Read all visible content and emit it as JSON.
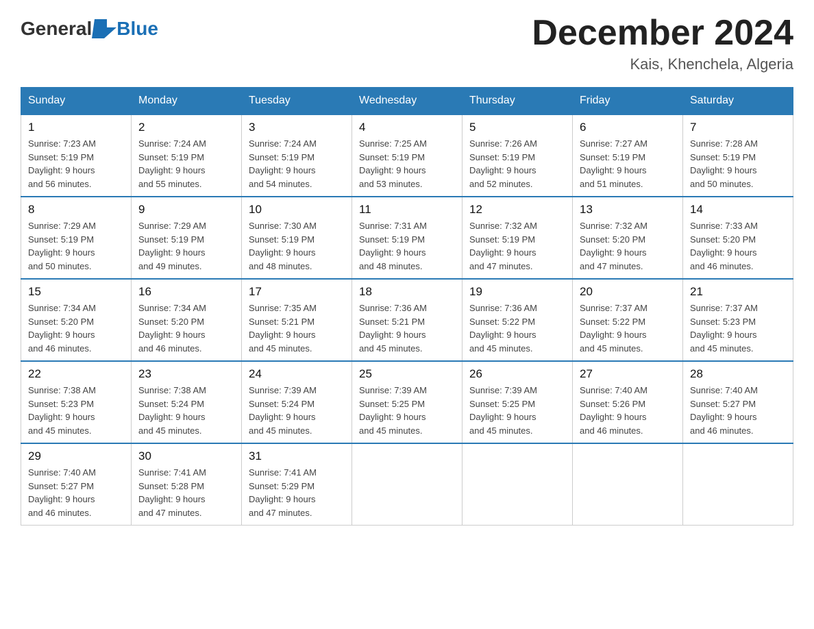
{
  "header": {
    "logo": {
      "general": "General",
      "blue": "Blue"
    },
    "title": "December 2024",
    "location": "Kais, Khenchela, Algeria"
  },
  "weekdays": [
    "Sunday",
    "Monday",
    "Tuesday",
    "Wednesday",
    "Thursday",
    "Friday",
    "Saturday"
  ],
  "weeks": [
    [
      {
        "day": "1",
        "sunrise": "7:23 AM",
        "sunset": "5:19 PM",
        "daylight": "9 hours and 56 minutes."
      },
      {
        "day": "2",
        "sunrise": "7:24 AM",
        "sunset": "5:19 PM",
        "daylight": "9 hours and 55 minutes."
      },
      {
        "day": "3",
        "sunrise": "7:24 AM",
        "sunset": "5:19 PM",
        "daylight": "9 hours and 54 minutes."
      },
      {
        "day": "4",
        "sunrise": "7:25 AM",
        "sunset": "5:19 PM",
        "daylight": "9 hours and 53 minutes."
      },
      {
        "day": "5",
        "sunrise": "7:26 AM",
        "sunset": "5:19 PM",
        "daylight": "9 hours and 52 minutes."
      },
      {
        "day": "6",
        "sunrise": "7:27 AM",
        "sunset": "5:19 PM",
        "daylight": "9 hours and 51 minutes."
      },
      {
        "day": "7",
        "sunrise": "7:28 AM",
        "sunset": "5:19 PM",
        "daylight": "9 hours and 50 minutes."
      }
    ],
    [
      {
        "day": "8",
        "sunrise": "7:29 AM",
        "sunset": "5:19 PM",
        "daylight": "9 hours and 50 minutes."
      },
      {
        "day": "9",
        "sunrise": "7:29 AM",
        "sunset": "5:19 PM",
        "daylight": "9 hours and 49 minutes."
      },
      {
        "day": "10",
        "sunrise": "7:30 AM",
        "sunset": "5:19 PM",
        "daylight": "9 hours and 48 minutes."
      },
      {
        "day": "11",
        "sunrise": "7:31 AM",
        "sunset": "5:19 PM",
        "daylight": "9 hours and 48 minutes."
      },
      {
        "day": "12",
        "sunrise": "7:32 AM",
        "sunset": "5:19 PM",
        "daylight": "9 hours and 47 minutes."
      },
      {
        "day": "13",
        "sunrise": "7:32 AM",
        "sunset": "5:20 PM",
        "daylight": "9 hours and 47 minutes."
      },
      {
        "day": "14",
        "sunrise": "7:33 AM",
        "sunset": "5:20 PM",
        "daylight": "9 hours and 46 minutes."
      }
    ],
    [
      {
        "day": "15",
        "sunrise": "7:34 AM",
        "sunset": "5:20 PM",
        "daylight": "9 hours and 46 minutes."
      },
      {
        "day": "16",
        "sunrise": "7:34 AM",
        "sunset": "5:20 PM",
        "daylight": "9 hours and 46 minutes."
      },
      {
        "day": "17",
        "sunrise": "7:35 AM",
        "sunset": "5:21 PM",
        "daylight": "9 hours and 45 minutes."
      },
      {
        "day": "18",
        "sunrise": "7:36 AM",
        "sunset": "5:21 PM",
        "daylight": "9 hours and 45 minutes."
      },
      {
        "day": "19",
        "sunrise": "7:36 AM",
        "sunset": "5:22 PM",
        "daylight": "9 hours and 45 minutes."
      },
      {
        "day": "20",
        "sunrise": "7:37 AM",
        "sunset": "5:22 PM",
        "daylight": "9 hours and 45 minutes."
      },
      {
        "day": "21",
        "sunrise": "7:37 AM",
        "sunset": "5:23 PM",
        "daylight": "9 hours and 45 minutes."
      }
    ],
    [
      {
        "day": "22",
        "sunrise": "7:38 AM",
        "sunset": "5:23 PM",
        "daylight": "9 hours and 45 minutes."
      },
      {
        "day": "23",
        "sunrise": "7:38 AM",
        "sunset": "5:24 PM",
        "daylight": "9 hours and 45 minutes."
      },
      {
        "day": "24",
        "sunrise": "7:39 AM",
        "sunset": "5:24 PM",
        "daylight": "9 hours and 45 minutes."
      },
      {
        "day": "25",
        "sunrise": "7:39 AM",
        "sunset": "5:25 PM",
        "daylight": "9 hours and 45 minutes."
      },
      {
        "day": "26",
        "sunrise": "7:39 AM",
        "sunset": "5:25 PM",
        "daylight": "9 hours and 45 minutes."
      },
      {
        "day": "27",
        "sunrise": "7:40 AM",
        "sunset": "5:26 PM",
        "daylight": "9 hours and 46 minutes."
      },
      {
        "day": "28",
        "sunrise": "7:40 AM",
        "sunset": "5:27 PM",
        "daylight": "9 hours and 46 minutes."
      }
    ],
    [
      {
        "day": "29",
        "sunrise": "7:40 AM",
        "sunset": "5:27 PM",
        "daylight": "9 hours and 46 minutes."
      },
      {
        "day": "30",
        "sunrise": "7:41 AM",
        "sunset": "5:28 PM",
        "daylight": "9 hours and 47 minutes."
      },
      {
        "day": "31",
        "sunrise": "7:41 AM",
        "sunset": "5:29 PM",
        "daylight": "9 hours and 47 minutes."
      },
      null,
      null,
      null,
      null
    ]
  ],
  "labels": {
    "sunrise_prefix": "Sunrise: ",
    "sunset_prefix": "Sunset: ",
    "daylight_prefix": "Daylight: "
  }
}
